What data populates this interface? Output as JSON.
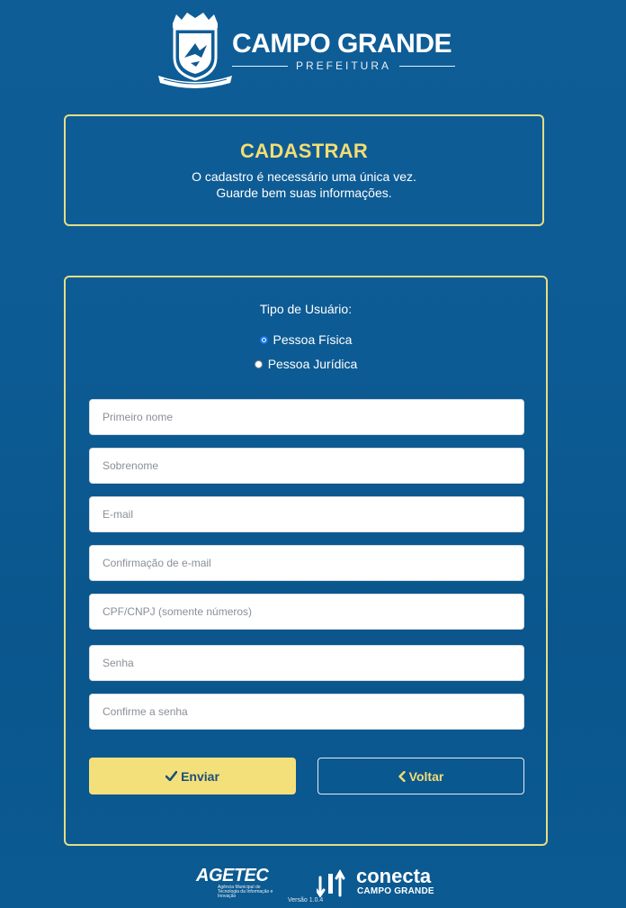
{
  "header": {
    "brand_name": "CAMPO GRANDE",
    "brand_sub": "PREFEITURA"
  },
  "title_box": {
    "title": "CADASTRAR",
    "line1": "O cadastro é necessário uma única vez.",
    "line2": "Guarde bem suas informações."
  },
  "form": {
    "user_type_label": "Tipo de Usuário:",
    "options": [
      {
        "label": "Pessoa Física",
        "checked": true
      },
      {
        "label": "Pessoa Jurídica",
        "checked": false
      }
    ],
    "fields": {
      "first_name": {
        "placeholder": "Primeiro nome",
        "value": ""
      },
      "last_name": {
        "placeholder": "Sobrenome",
        "value": ""
      },
      "email": {
        "placeholder": "E-mail",
        "value": ""
      },
      "email_confirm": {
        "placeholder": "Confirmação de e-mail",
        "value": ""
      },
      "cpf_cnpj": {
        "placeholder": "CPF/CNPJ (somente números)",
        "value": ""
      },
      "password": {
        "placeholder": "Senha",
        "value": ""
      },
      "password_confirm": {
        "placeholder": "Confirme a senha",
        "value": ""
      }
    },
    "submit_label": "Enviar",
    "back_label": "Voltar"
  },
  "footer": {
    "agetec_name": "AGETEC",
    "agetec_desc": "Agência Municipal de Tecnologia da Informação e Inovação",
    "conecta_name": "conecta",
    "conecta_sub": "CAMPO GRANDE",
    "version": "Versão 1.0.4"
  },
  "colors": {
    "background": "#0d5b94",
    "accent_yellow": "#f4e07a",
    "border_yellow": "#e6dd84"
  },
  "icons": {
    "submit": "check-icon",
    "back": "chevron-left-icon",
    "crest": "city-crest-icon",
    "conecta": "conecta-arrows-icon"
  }
}
